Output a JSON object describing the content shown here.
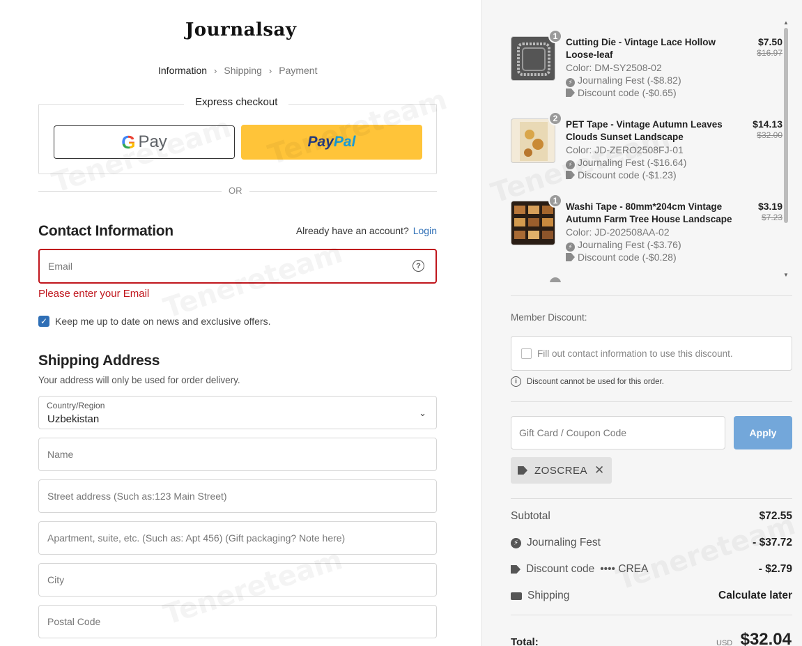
{
  "brand": {
    "logo": "Journalsay"
  },
  "breadcrumb": {
    "steps": [
      "Information",
      "Shipping",
      "Payment"
    ]
  },
  "express": {
    "title": "Express checkout",
    "gpay_label": "Pay",
    "paypal_pay": "Pay",
    "paypal_pal": "Pal"
  },
  "or_label": "OR",
  "contact": {
    "title": "Contact Information",
    "have_account": "Already have an account?",
    "login_label": "Login",
    "email_placeholder": "Email",
    "email_error": "Please enter your Email",
    "newsletter_label": "Keep me up to date on news and exclusive offers.",
    "newsletter_checked": true
  },
  "shipping": {
    "title": "Shipping Address",
    "note": "Your address will only be used for order delivery.",
    "country_label": "Country/Region",
    "country_value": "Uzbekistan",
    "name_placeholder": "Name",
    "street_placeholder": "Street address (Such as:123 Main Street)",
    "apt_placeholder": "Apartment, suite, etc. (Such as: Apt 456) (Gift packaging? Note here)",
    "city_placeholder": "City",
    "postal_placeholder": "Postal Code"
  },
  "cart": {
    "items": [
      {
        "qty": "1",
        "name": "Cutting Die - Vintage Lace Hollow Loose-leaf",
        "color": "Color: DM-SY2508-02",
        "fest": "Journaling Fest (-$8.82)",
        "discount": "Discount code (-$0.65)",
        "price": "$7.50",
        "old_price": "$16.97"
      },
      {
        "qty": "2",
        "name": "PET Tape - Vintage Autumn Leaves Clouds Sunset Landscape",
        "color": "Color: JD-ZERO2508FJ-01",
        "fest": "Journaling Fest (-$16.64)",
        "discount": "Discount code (-$1.23)",
        "price": "$14.13",
        "old_price": "$32.00"
      },
      {
        "qty": "1",
        "name": "Washi Tape - 80mm*204cm Vintage Autumn Farm Tree House Landscape",
        "color": "Color: JD-202508AA-02",
        "fest": "Journaling Fest (-$3.76)",
        "discount": "Discount code (-$0.28)",
        "price": "$3.19",
        "old_price": "$7.23"
      }
    ]
  },
  "member": {
    "label": "Member Discount:",
    "checkbox_label": "Fill out contact information to use this discount.",
    "note": "Discount cannot be used for this order."
  },
  "coupon": {
    "placeholder": "Gift Card / Coupon Code",
    "apply_label": "Apply",
    "applied_code": "ZOSCREA"
  },
  "summary": {
    "subtotal_label": "Subtotal",
    "subtotal_value": "$72.55",
    "fest_label": "Journaling Fest",
    "fest_value": "- $37.72",
    "discount_label": "Discount code",
    "discount_code": "•••• CREA",
    "discount_value": "- $2.79",
    "shipping_label": "Shipping",
    "shipping_value": "Calculate later",
    "total_label": "Total:",
    "total_currency": "USD",
    "total_value": "$32.04"
  },
  "watermark": "Tenereteam",
  "colors": {
    "accent": "#2f6fb6",
    "error": "#c0161d",
    "paypal": "#ffc439",
    "apply": "#73a7da"
  }
}
